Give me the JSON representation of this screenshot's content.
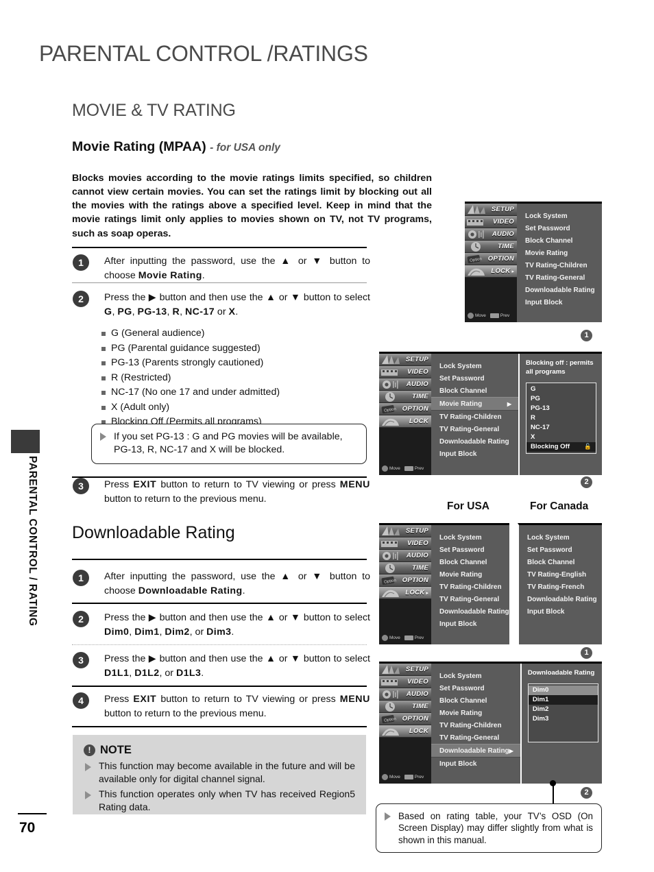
{
  "document": {
    "chapter_title": "PARENTAL CONTROL /RATINGS",
    "section_title": "MOVIE & TV RATING",
    "subsection_title": "Movie Rating (MPAA)",
    "subsection_suffix": "- for USA only",
    "side_tab_text": "PARENTAL CONTROL / RATING",
    "page_number": "70"
  },
  "intro": {
    "paragraph": "Blocks movies according to the movie ratings limits specified, so children cannot view certain movies. You can set the ratings limit by blocking out all the movies with the ratings above a specified level. Keep in mind that the movie ratings limit only applies to movies shown on TV, not TV programs, such as soap operas."
  },
  "movie_steps": [
    {
      "number": "1",
      "html": "After inputting the password, use the ▲ or ▼ button to choose <b>Movie Rating</b>."
    },
    {
      "number": "2",
      "html": "Press the ▶ button and then use the ▲ or ▼ button to select <b>G</b>, <b>PG</b>, <b>PG-13</b>, <b>R</b>, <b>NC-17</b> or <b>X</b>."
    },
    {
      "number": "3",
      "html": "Press <span class=\"kbd\">EXIT</span> button to return to TV viewing or press <span class=\"kbd\">MENU</span> button to return to the previous menu."
    }
  ],
  "rating_bullets": [
    "G (General audience)",
    "PG (Parental guidance suggested)",
    "PG-13 (Parents strongly cautioned)",
    "R (Restricted)",
    "NC-17 (No one 17 and under admitted)",
    "X (Adult only)",
    "Blocking Off (Permits all programs)"
  ],
  "tip_pg13": "If you set PG-13 : G and PG movies will be available, PG-13, R, NC-17 and X will be blocked.",
  "downloadable": {
    "heading": "Downloadable Rating",
    "steps": [
      {
        "number": "1",
        "html": "After inputting the password, use the ▲ or ▼ button to choose <b>Downloadable Rating</b>."
      },
      {
        "number": "2",
        "html": "Press the ▶ button and then use the ▲ or ▼ button to select <b>Dim0</b>, <b>Dim1</b>, <b>Dim2</b>, or <b>Dim3</b>."
      },
      {
        "number": "3",
        "html": "Press the ▶ button and then use the ▲ or ▼ button to select <b>D1L1</b>, <b>D1L2</b>, or <b>D1L3</b>."
      },
      {
        "number": "4",
        "html": "Press <span class=\"kbd\">EXIT</span> button to return to TV viewing or press <span class=\"kbd\">MENU</span> button to return to the previous menu."
      }
    ]
  },
  "note": {
    "icon": "!",
    "title": "NOTE",
    "items": [
      "This function may become available in the future and will be available only for digital channel signal.",
      "This function operates only when TV has received Region5 Rating data."
    ]
  },
  "tip_osd": "Based on rating table, your TV’s OSD (On Screen Display) may differ slightly from what is shown in this manual.",
  "region_labels": {
    "usa": "For USA",
    "canada": "For Canada"
  },
  "osd_sidebar": {
    "items": [
      {
        "label": "SETUP",
        "icon": "setup-icon",
        "active": false
      },
      {
        "label": "VIDEO",
        "icon": "video-icon",
        "active": false
      },
      {
        "label": "AUDIO",
        "icon": "audio-icon",
        "active": false
      },
      {
        "label": "TIME",
        "icon": "time-icon",
        "active": false
      },
      {
        "label": "OPTION",
        "icon": "option-icon",
        "active": false
      },
      {
        "label": "LOCK",
        "icon": "lock-icon",
        "active": true
      }
    ],
    "footer": {
      "move": "Move",
      "prev": "Prev"
    }
  },
  "osd_panels": {
    "panel1": {
      "callout": "1",
      "lock_selected": true,
      "menu": [
        "Lock System",
        "Set Password",
        "Block Channel",
        "Movie Rating",
        "TV Rating-Children",
        "TV Rating-General",
        "Downloadable Rating",
        "Input Block"
      ]
    },
    "panel2": {
      "callout": "2",
      "menu": [
        "Lock System",
        "Set Password",
        "Block Channel",
        "Movie Rating",
        "TV Rating-Children",
        "TV Rating-General",
        "Downloadable Rating",
        "Input Block"
      ],
      "selected_item": "Movie Rating",
      "detail_heading": "Blocking off : permits all programs",
      "options": [
        {
          "label": "G",
          "state": "normal"
        },
        {
          "label": "PG",
          "state": "normal"
        },
        {
          "label": "PG-13",
          "state": "normal"
        },
        {
          "label": "R",
          "state": "normal"
        },
        {
          "label": "NC-17",
          "state": "normal"
        },
        {
          "label": "X",
          "state": "normal"
        },
        {
          "label": "Blocking Off",
          "state": "highlighted",
          "icon": "unlock-icon"
        }
      ]
    },
    "panel_usa": {
      "callout": "1",
      "lock_selected": true,
      "menu": [
        "Lock System",
        "Set Password",
        "Block Channel",
        "Movie Rating",
        "TV Rating-Children",
        "TV Rating-General",
        "Downloadable Rating",
        "Input Block"
      ]
    },
    "panel_canada": {
      "menu": [
        "Lock System",
        "Set Password",
        "Block Channel",
        "TV Rating-English",
        "TV Rating-French",
        "Downloadable Rating",
        "Input Block"
      ]
    },
    "panel3": {
      "callout": "2",
      "menu": [
        "Lock System",
        "Set Password",
        "Block Channel",
        "Movie Rating",
        "TV Rating-Children",
        "TV Rating-General",
        "Downloadable Rating",
        "Input Block"
      ],
      "selected_item": "Downloadable Rating",
      "detail_heading": "Downloadable Rating",
      "options": [
        {
          "label": "Dim0",
          "state": "light"
        },
        {
          "label": "Dim1",
          "state": "highlighted"
        },
        {
          "label": "Dim2",
          "state": "normal"
        },
        {
          "label": "Dim3",
          "state": "normal"
        }
      ]
    }
  }
}
